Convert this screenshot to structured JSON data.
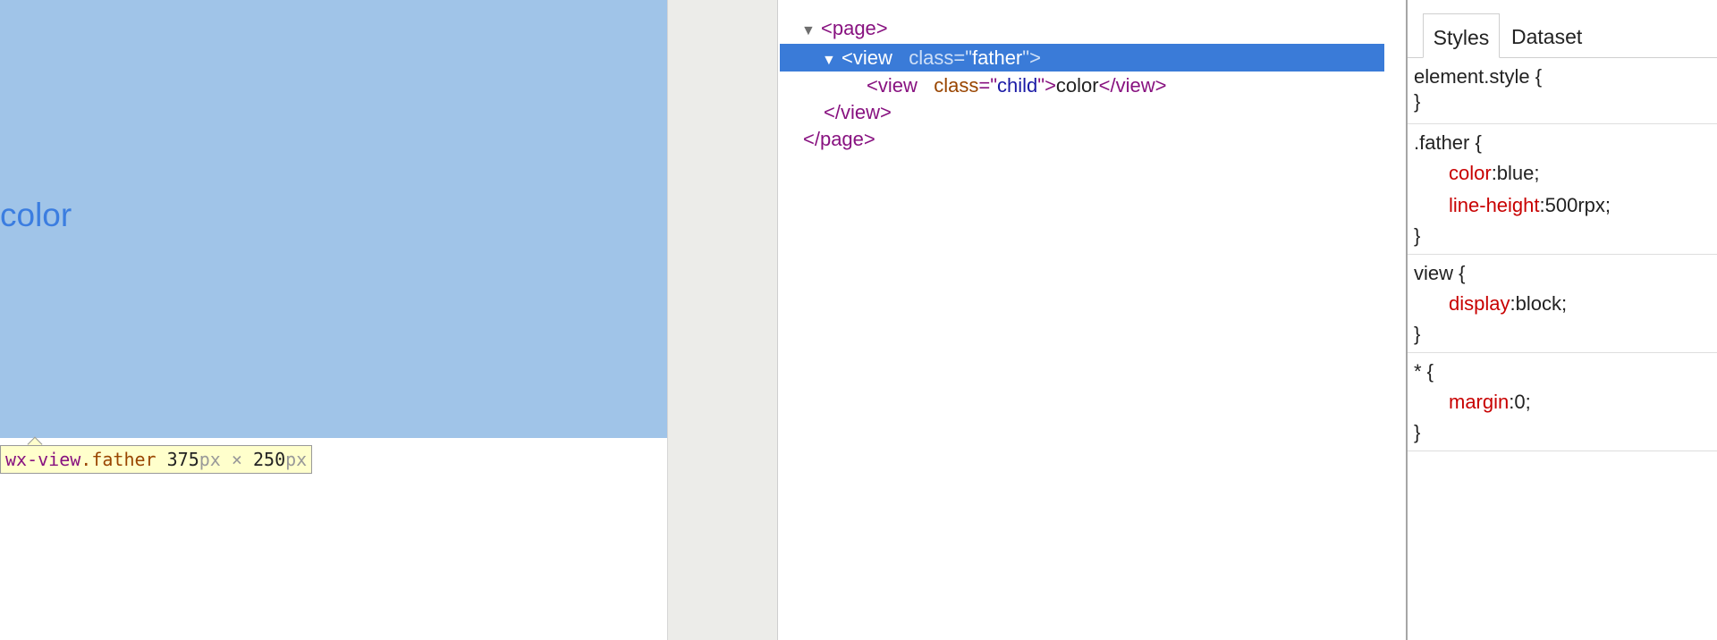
{
  "preview": {
    "child_text": "color",
    "tooltip": {
      "tag": "wx-view",
      "class": ".father",
      "width": "375",
      "width_unit": "px",
      "times": " × ",
      "height": "250",
      "height_unit": "px"
    },
    "highlight_color": "#a0c4e8"
  },
  "dom_tree": {
    "page_open": "<page>",
    "view_open_tag": "<view",
    "view_attr_name": "class",
    "eq": "=",
    "quote": "\"",
    "father_value": "father",
    "gt": ">",
    "child_value": "child",
    "child_text": "color",
    "view_close": "</view>",
    "page_close": "</page>",
    "selected_color": "#3a7bd8"
  },
  "styles": {
    "tabs": [
      {
        "label": "Styles",
        "active": true
      },
      {
        "label": "Dataset",
        "active": false
      }
    ],
    "rules": [
      {
        "selector": "element.style {",
        "close": "}",
        "props": []
      },
      {
        "selector": ".father {",
        "close": "}",
        "props": [
          {
            "name": "color",
            "value": ":blue;"
          },
          {
            "name": "line-height",
            "value": ":500rpx;"
          }
        ]
      },
      {
        "selector": "view {",
        "close": "}",
        "props": [
          {
            "name": "display",
            "value": ":block;"
          }
        ]
      },
      {
        "selector": "* {",
        "close": "}",
        "props": [
          {
            "name": "margin",
            "value": ":0;"
          }
        ]
      }
    ]
  }
}
